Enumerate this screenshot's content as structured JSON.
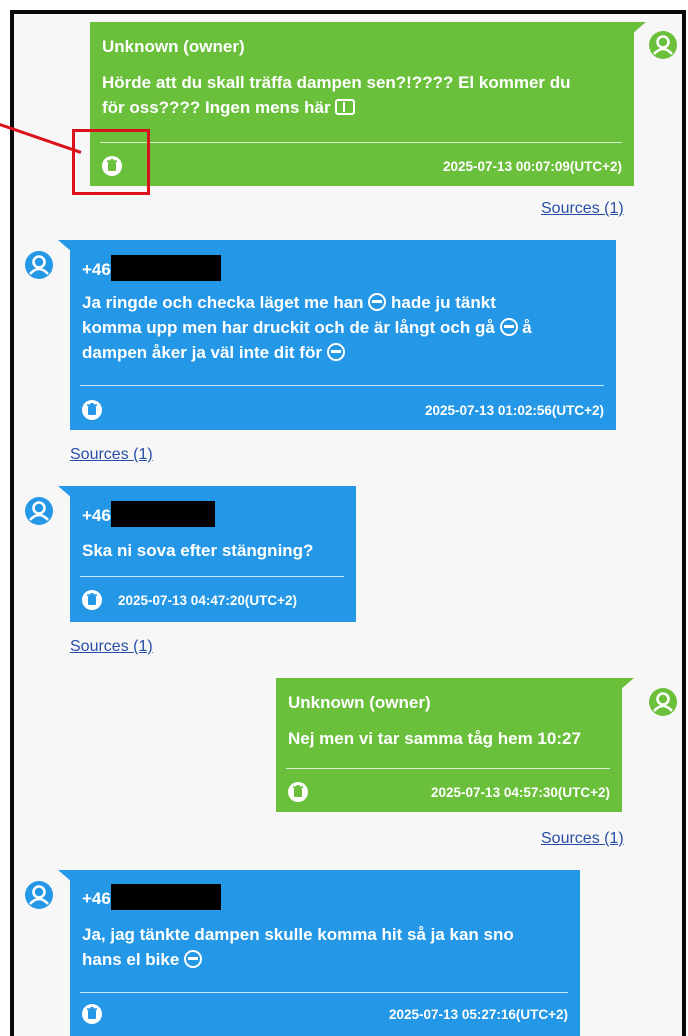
{
  "colors": {
    "outgoing": "#6abf3b",
    "incoming": "#2497e6",
    "annotation": "#d9121b",
    "link": "#2a4ea8"
  },
  "sources_label": "Sources (1)",
  "messages": [
    {
      "direction": "outgoing",
      "sender": "Unknown (owner)",
      "text_line1": "Hörde att du skall träffa dampen sen?!???? El kommer du",
      "text_line2": "för oss???? Ingen mens här",
      "timestamp": "2025-07-13 00:07:09(UTC+2)",
      "trailing_icon": "book-emoji-icon"
    },
    {
      "direction": "incoming",
      "sender_prefix": "+46",
      "sender_redacted": true,
      "text_line1a": "Ja ringde och checka läget me han",
      "text_line1b": "hade ju tänkt",
      "text_line2a": "komma upp men har druckit och de är långt och gå",
      "text_line2b": "å",
      "text_line3": "dampen åker ja väl inte dit för",
      "timestamp": "2025-07-13 01:02:56(UTC+2)"
    },
    {
      "direction": "incoming",
      "sender_prefix": "+46",
      "sender_redacted": true,
      "text_line1": "Ska ni sova efter stängning?",
      "timestamp": "2025-07-13 04:47:20(UTC+2)"
    },
    {
      "direction": "outgoing",
      "sender": "Unknown (owner)",
      "text_line1": "Nej men vi tar samma tåg hem 10:27",
      "timestamp": "2025-07-13 04:57:30(UTC+2)"
    },
    {
      "direction": "incoming",
      "sender_prefix": "+46",
      "sender_redacted": true,
      "text_line1": "Ja, jag tänkte dampen skulle komma hit så ja kan sno",
      "text_line2": "hans el bike",
      "timestamp": "2025-07-13 05:27:16(UTC+2)"
    }
  ]
}
